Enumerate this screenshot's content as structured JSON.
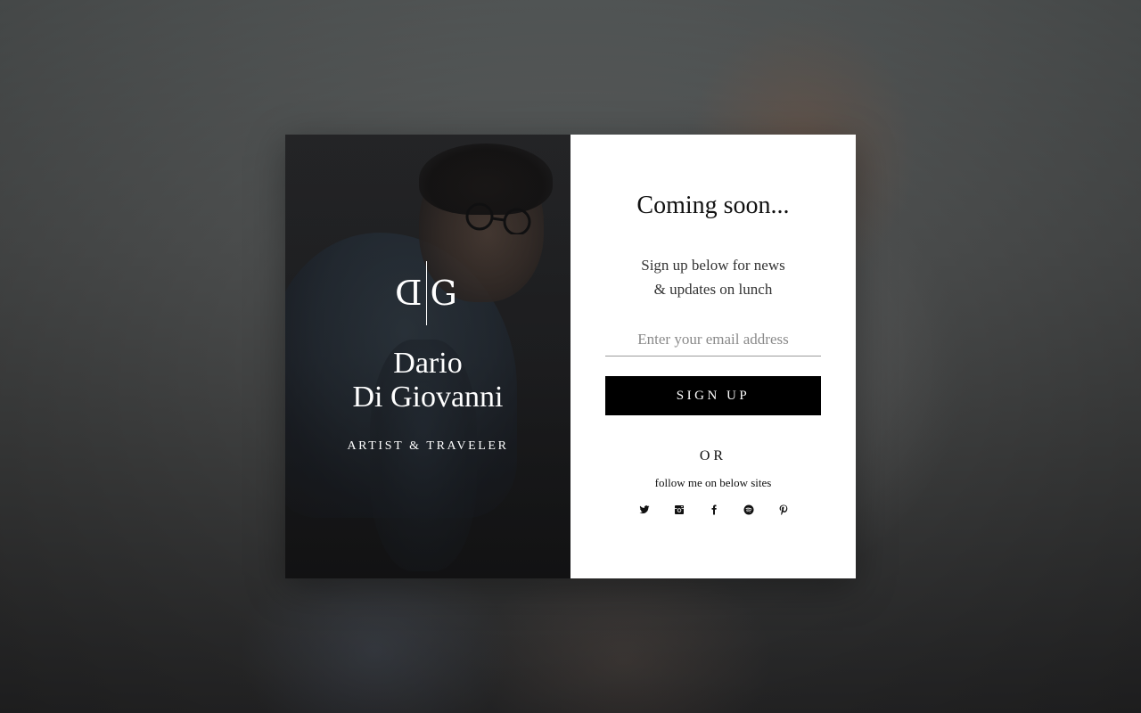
{
  "profile": {
    "monogram_left": "D",
    "monogram_right": "G",
    "name_line1": "Dario",
    "name_line2": "Di Giovanni",
    "tagline": "ARTIST & TRAVELER"
  },
  "signup": {
    "title": "Coming soon...",
    "subtitle_line1": "Sign up below for news",
    "subtitle_line2": "& updates on lunch",
    "email_placeholder": "Enter your email address",
    "button_label": "SIGN UP",
    "or_label": "OR",
    "follow_text": "follow me on below sites"
  },
  "socials": [
    {
      "icon": "twitter-icon"
    },
    {
      "icon": "instagram-icon"
    },
    {
      "icon": "facebook-icon"
    },
    {
      "icon": "spotify-icon"
    },
    {
      "icon": "pinterest-icon"
    }
  ],
  "colors": {
    "button_bg": "#000000",
    "panel_right_bg": "#ffffff",
    "panel_left_bg": "#242527"
  }
}
